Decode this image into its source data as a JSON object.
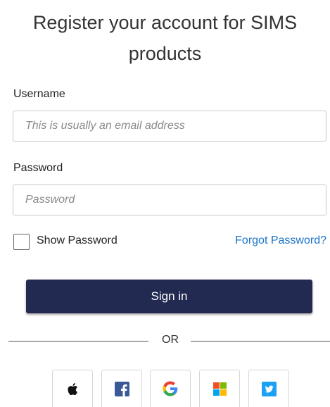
{
  "title": "Register your account for SIMS products",
  "username": {
    "label": "Username",
    "placeholder": "This is usually an email address"
  },
  "password": {
    "label": "Password",
    "placeholder": "Password"
  },
  "show_password_label": "Show Password",
  "forgot_password_label": "Forgot Password?",
  "sign_in_label": "Sign in",
  "divider_label": "OR",
  "social_providers": [
    {
      "icon": "apple-icon"
    },
    {
      "icon": "facebook-icon",
      "color": "#3b5998"
    },
    {
      "icon": "google-icon"
    },
    {
      "icon": "microsoft-icon"
    },
    {
      "icon": "twitter-icon",
      "color": "#1da1f2"
    }
  ],
  "colors": {
    "primary_button": "#232a52",
    "link": "#1a73c9"
  }
}
